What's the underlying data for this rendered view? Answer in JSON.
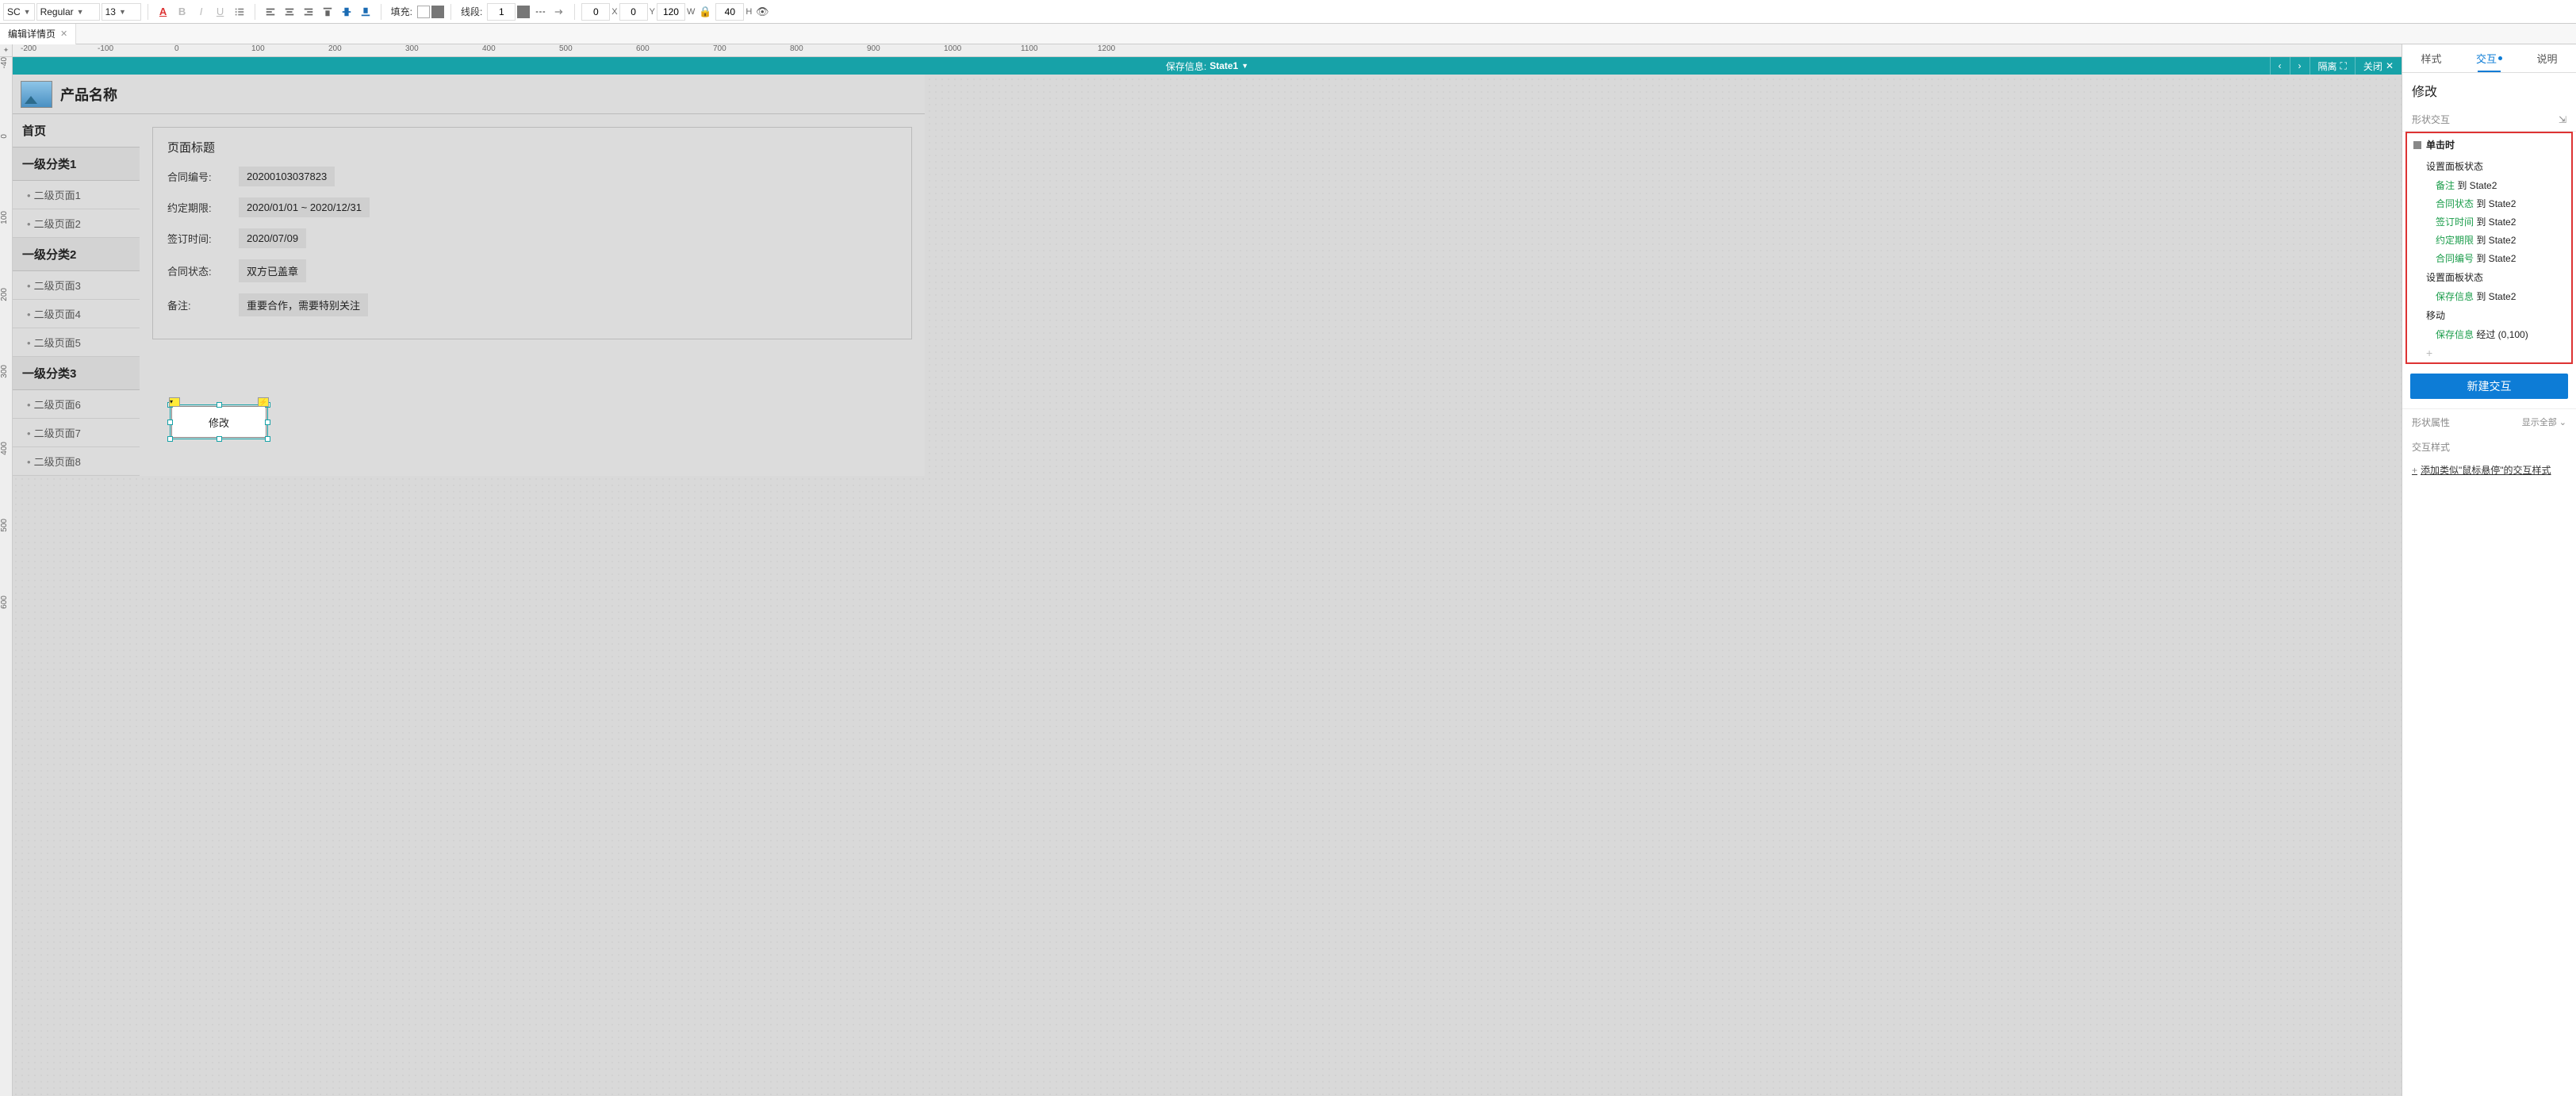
{
  "toolbar": {
    "font_family": "SC",
    "font_weight": "Regular",
    "font_size": "13",
    "fill_label": "填充:",
    "line_label": "线段:",
    "line_width": "1",
    "x": "0",
    "y": "0",
    "w": "120",
    "h": "40",
    "x_lbl": "X",
    "y_lbl": "Y",
    "w_lbl": "W",
    "h_lbl": "H"
  },
  "tab": {
    "title": "编辑详情页"
  },
  "ruler_h": [
    "-200",
    "-100",
    "0",
    "100",
    "200",
    "300",
    "400",
    "500",
    "600",
    "700",
    "800",
    "900",
    "1000",
    "1100",
    "1200"
  ],
  "ruler_v": [
    "-40",
    "0",
    "100",
    "200",
    "300",
    "400",
    "500",
    "600"
  ],
  "state_bar": {
    "label": "保存信息:",
    "state": "State1",
    "isolate": "隔离",
    "close": "关闭"
  },
  "page": {
    "product": "产品名称",
    "home": "首页",
    "cats": [
      {
        "name": "一级分类1",
        "items": [
          "二级页面1",
          "二级页面2"
        ]
      },
      {
        "name": "一级分类2",
        "items": [
          "二级页面3",
          "二级页面4",
          "二级页面5"
        ]
      },
      {
        "name": "一级分类3",
        "items": [
          "二级页面6",
          "二级页面7",
          "二级页面8"
        ]
      }
    ],
    "card_title": "页面标题",
    "fields": [
      {
        "label": "合同编号:",
        "value": "20200103037823"
      },
      {
        "label": "约定期限:",
        "value": "2020/01/01 ~ 2020/12/31"
      },
      {
        "label": "签订时间:",
        "value": "2020/07/09"
      },
      {
        "label": "合同状态:",
        "value": "双方已盖章"
      },
      {
        "label": "备注:",
        "value": "重要合作，需要特别关注"
      }
    ],
    "button_label": "修改"
  },
  "inspector": {
    "tabs": [
      "样式",
      "交互",
      "说明"
    ],
    "title": "修改",
    "shape_ix": "形状交互",
    "event": "单击时",
    "action1": "设置面板状态",
    "items1": [
      {
        "g": "备注",
        "rest": " 到 State2"
      },
      {
        "g": "合同状态",
        "rest": " 到 State2"
      },
      {
        "g": "签订时间",
        "rest": " 到 State2"
      },
      {
        "g": "约定期限",
        "rest": " 到 State2"
      },
      {
        "g": "合同编号",
        "rest": " 到 State2"
      }
    ],
    "action2": "设置面板状态",
    "items2": [
      {
        "g": "保存信息",
        "rest": " 到 State2"
      }
    ],
    "action3": "移动",
    "items3": [
      {
        "g": "保存信息",
        "rest": " 经过 (0,100)"
      }
    ],
    "new_btn": "新建交互",
    "shape_prop": "形状属性",
    "show_all": "显示全部",
    "ix_style": "交互样式",
    "add_hover": "添加类似\"鼠标悬停\"的交互样式"
  }
}
